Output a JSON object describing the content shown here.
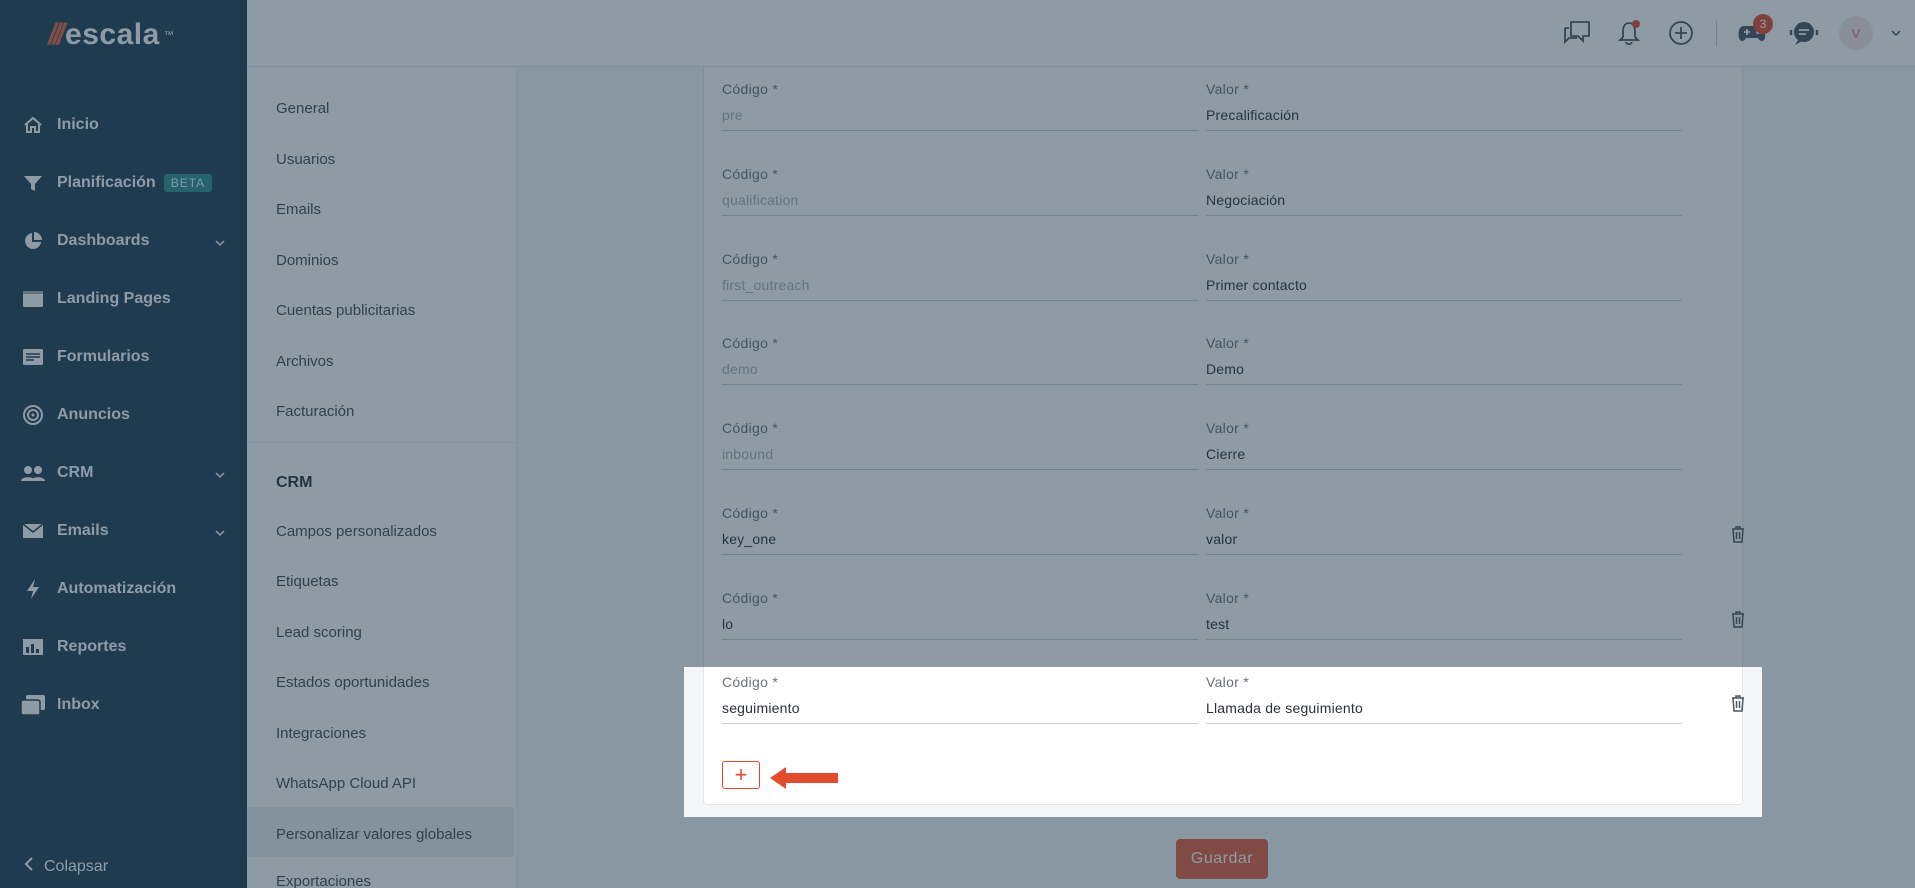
{
  "brand": {
    "name": "escala",
    "tm": "™"
  },
  "sidebar": {
    "items": [
      {
        "label": "Inicio",
        "icon": "home-icon",
        "chevron": false
      },
      {
        "label": "Planificación",
        "icon": "filter-icon",
        "chevron": false,
        "badge": "BETA"
      },
      {
        "label": "Dashboards",
        "icon": "pie-chart-icon",
        "chevron": true
      },
      {
        "label": "Landing Pages",
        "icon": "window-icon",
        "chevron": false
      },
      {
        "label": "Formularios",
        "icon": "form-icon",
        "chevron": false
      },
      {
        "label": "Anuncios",
        "icon": "target-icon",
        "chevron": false
      },
      {
        "label": "CRM",
        "icon": "users-icon",
        "chevron": true
      },
      {
        "label": "Emails",
        "icon": "envelope-icon",
        "chevron": true
      },
      {
        "label": "Automatización",
        "icon": "bolt-icon",
        "chevron": false
      },
      {
        "label": "Reportes",
        "icon": "report-icon",
        "chevron": false
      },
      {
        "label": "Inbox",
        "icon": "inbox-icon",
        "chevron": false
      }
    ],
    "collapse_label": "Colapsar"
  },
  "topbar": {
    "notification_count": "3",
    "avatar_initial": "V"
  },
  "subnav": {
    "settings_items": [
      "General",
      "Usuarios",
      "Emails",
      "Dominios",
      "Cuentas publicitarias",
      "Archivos",
      "Facturación"
    ],
    "crm_heading": "CRM",
    "crm_items": [
      "Campos personalizados",
      "Etiquetas",
      "Lead scoring",
      "Estados oportunidades",
      "Integraciones",
      "WhatsApp Cloud API",
      "Personalizar valores globales",
      "Exportaciones"
    ]
  },
  "form": {
    "code_label": "Código *",
    "value_label": "Valor *",
    "rows": [
      {
        "code": "pre",
        "value": "Precalificación",
        "editable": false
      },
      {
        "code": "qualification",
        "value": "Negociación",
        "editable": false
      },
      {
        "code": "first_outreach",
        "value": "Primer contacto",
        "editable": false
      },
      {
        "code": "demo",
        "value": "Demo",
        "editable": false
      },
      {
        "code": "inbound",
        "value": "Cierre",
        "editable": false
      },
      {
        "code": "key_one",
        "value": "valor",
        "editable": true
      },
      {
        "code": "lo",
        "value": "test",
        "editable": true
      },
      {
        "code": "seguimiento",
        "value": "Llamada de seguimiento",
        "editable": true
      }
    ],
    "add_label": "+",
    "save_label": "Guardar"
  },
  "colors": {
    "sidebar": "#1f3f55",
    "accent": "#e45f3f",
    "overlay": "rgba(30,55,75,0.50)"
  }
}
